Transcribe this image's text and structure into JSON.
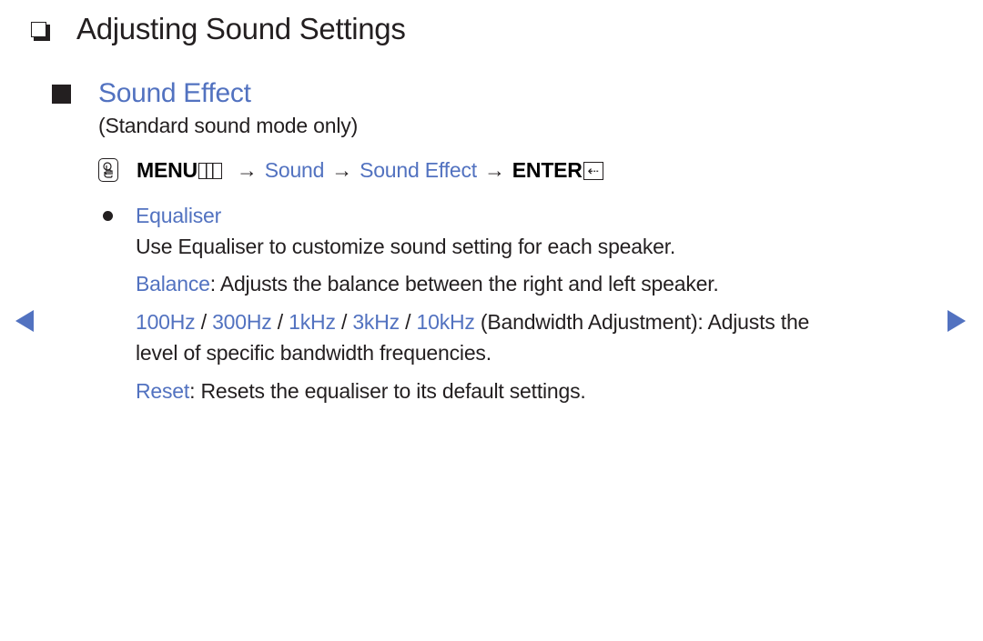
{
  "page": {
    "title": "Adjusting Sound Settings",
    "section": {
      "title": "Sound Effect",
      "note": "(Standard sound mode only)"
    },
    "menu_path": {
      "menu_label": "MENU",
      "arrow": "→",
      "step1": "Sound",
      "step2": "Sound Effect",
      "enter_label": "ENTER",
      "enter_glyph": "⇠"
    },
    "item": {
      "label": "Equaliser",
      "description": "Use Equaliser to customize sound setting for each speaker.",
      "balance": {
        "term": "Balance",
        "text": ": Adjusts the balance between the right and left speaker."
      },
      "bandwidth": {
        "freqs": [
          "100Hz",
          "300Hz",
          "1kHz",
          "3kHz",
          "10kHz"
        ],
        "separator": " / ",
        "text_line1": " (Bandwidth Adjustment): Adjusts the",
        "text_line2": "level of specific bandwidth frequencies."
      },
      "reset": {
        "term": "Reset",
        "text": ": Resets the equaliser to its default settings."
      }
    },
    "colors": {
      "accent": "#5272c0",
      "text": "#231f20"
    },
    "nav": {
      "prev_icon": "triangle-left",
      "next_icon": "triangle-right"
    }
  }
}
